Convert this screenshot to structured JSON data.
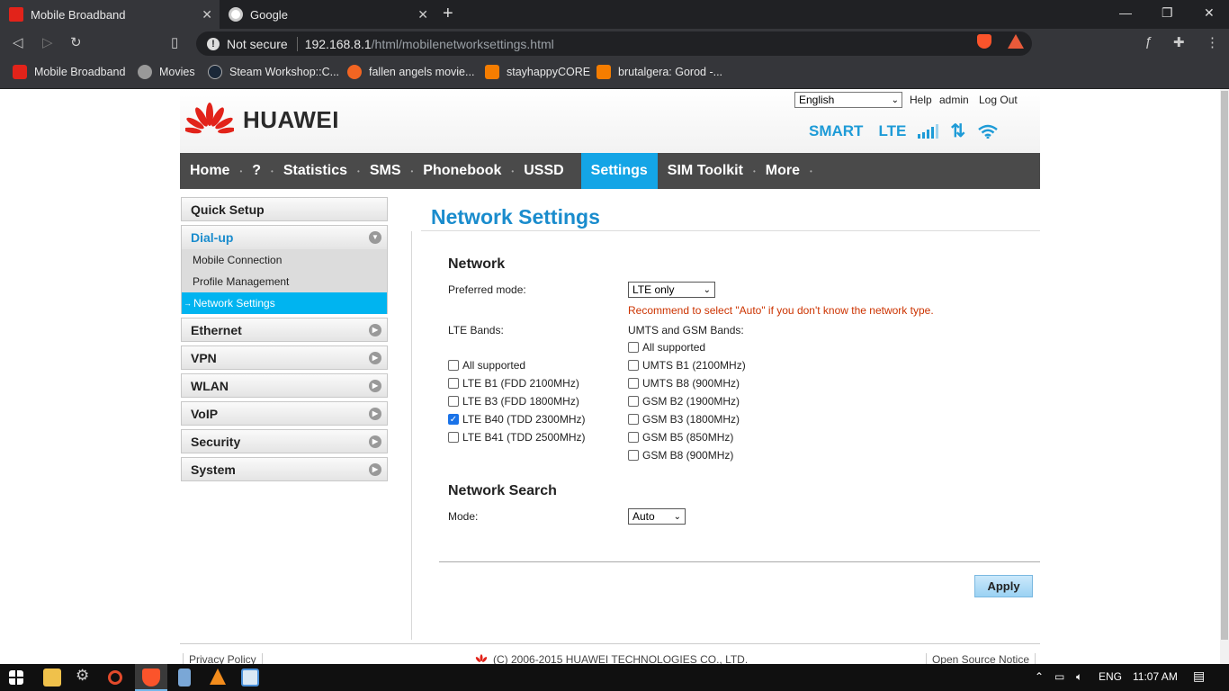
{
  "browser": {
    "tabs": [
      {
        "title": "Mobile Broadband",
        "icon": "huawei-icon"
      },
      {
        "title": "Google",
        "icon": "google-icon"
      }
    ],
    "address": {
      "security": "Not secure",
      "host": "192.168.8.1",
      "path": "/html/mobilenetworksettings.html"
    },
    "bookmarks": [
      {
        "label": "Mobile Broadband",
        "icon": "huawei-icon"
      },
      {
        "label": "Movies",
        "icon": "globe-icon"
      },
      {
        "label": "Steam Workshop::C...",
        "icon": "steam-icon"
      },
      {
        "label": "fallen angels movie...",
        "icon": "orange-icon"
      },
      {
        "label": "stayhappyCORE",
        "icon": "blogger-icon"
      },
      {
        "label": "brutalgera: Gorod -...",
        "icon": "blogger-icon"
      }
    ]
  },
  "header": {
    "brand": "HUAWEI",
    "language": "English",
    "links": {
      "help": "Help",
      "user": "admin",
      "logout": "Log Out"
    },
    "status": {
      "smart": "SMART",
      "network": "LTE"
    }
  },
  "nav": {
    "items": [
      "Home",
      "?",
      "Statistics",
      "SMS",
      "Phonebook",
      "USSD",
      "Settings",
      "SIM Toolkit",
      "More"
    ],
    "active": "Settings"
  },
  "sidebar": {
    "quick_setup": "Quick Setup",
    "dialup": "Dial-up",
    "dialup_items": [
      "Mobile Connection",
      "Profile Management",
      "Network Settings"
    ],
    "active_prefix": "→",
    "groups": [
      "Ethernet",
      "VPN",
      "WLAN",
      "VoIP",
      "Security",
      "System"
    ]
  },
  "main": {
    "title": "Network Settings",
    "network": {
      "heading": "Network",
      "preferred_mode_label": "Preferred mode:",
      "preferred_mode_value": "LTE only",
      "recommend": "Recommend to select \"Auto\" if you don't know the network type.",
      "lte_bands_label": "LTE Bands:",
      "umts_bands_label": "UMTS and GSM Bands:",
      "lte_bands": [
        {
          "label": "All supported",
          "checked": false
        },
        {
          "label": "LTE B1 (FDD 2100MHz)",
          "checked": false
        },
        {
          "label": "LTE B3 (FDD 1800MHz)",
          "checked": false
        },
        {
          "label": "LTE B40 (TDD 2300MHz)",
          "checked": true
        },
        {
          "label": "LTE B41 (TDD 2500MHz)",
          "checked": false
        }
      ],
      "umts_bands": [
        {
          "label": "All supported",
          "checked": false
        },
        {
          "label": "UMTS B1 (2100MHz)",
          "checked": false
        },
        {
          "label": "UMTS B8 (900MHz)",
          "checked": false
        },
        {
          "label": "GSM B2 (1900MHz)",
          "checked": false
        },
        {
          "label": "GSM B3 (1800MHz)",
          "checked": false
        },
        {
          "label": "GSM B5 (850MHz)",
          "checked": false
        },
        {
          "label": "GSM B8 (900MHz)",
          "checked": false
        }
      ]
    },
    "search": {
      "heading": "Network Search",
      "mode_label": "Mode:",
      "mode_value": "Auto"
    },
    "apply": "Apply"
  },
  "footer": {
    "privacy": "Privacy Policy",
    "copyright": "(C) 2006-2015 HUAWEI TECHNOLOGIES CO., LTD.",
    "open_source": "Open Source Notice"
  },
  "taskbar": {
    "lang": "ENG",
    "time": "11:07 AM"
  },
  "colors": {
    "accent": "#14a5e6",
    "nav_bg": "#4a4a4a",
    "warning": "#cc3300",
    "brand_red": "#e2231a"
  }
}
